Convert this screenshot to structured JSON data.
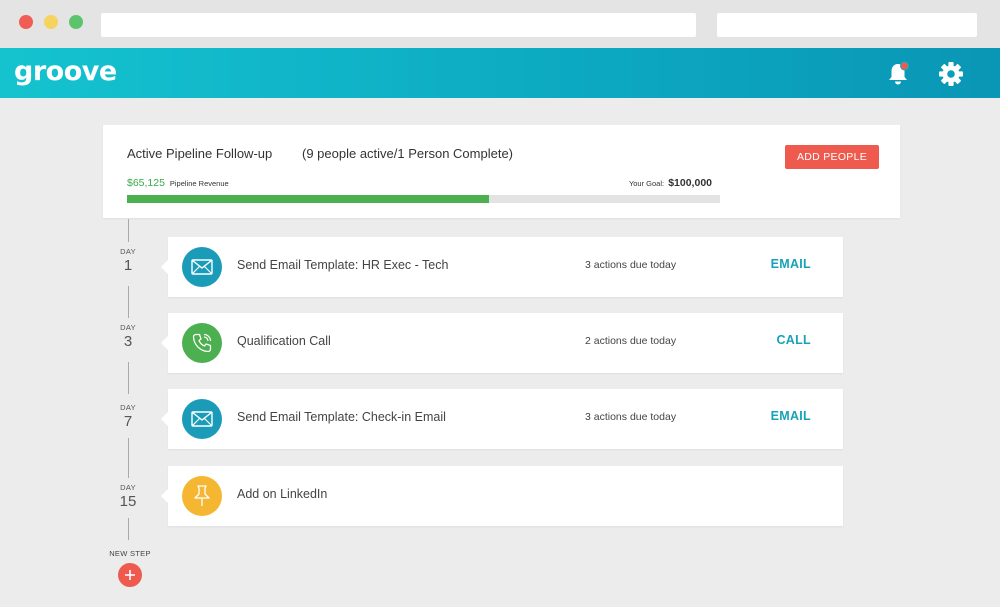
{
  "app": {
    "logo": "groove"
  },
  "header": {
    "icons": [
      "bell-icon",
      "gear-icon"
    ],
    "notification_dot_color": "#ef5a4e"
  },
  "pipeline": {
    "title": "Active Pipeline Follow-up",
    "status": "(9 people active/1 Person Complete)",
    "add_button": "ADD PEOPLE",
    "revenue_amount": "$65,125",
    "revenue_label": "Pipeline Revenue",
    "goal_label": "Your Goal:",
    "goal_value": "$100,000",
    "progress_fraction": 0.61
  },
  "steps": [
    {
      "day_label": "DAY",
      "day": "1",
      "icon": "email-icon",
      "color": "#1a9cb8",
      "title": "Send Email Template: HR Exec - Tech",
      "due": "3 actions due today",
      "action": "EMAIL"
    },
    {
      "day_label": "DAY",
      "day": "3",
      "icon": "phone-icon",
      "color": "#4caf50",
      "title": "Qualification Call",
      "due": "2 actions due today",
      "action": "CALL"
    },
    {
      "day_label": "DAY",
      "day": "7",
      "icon": "email-icon",
      "color": "#1a9cb8",
      "title": "Send Email Template: Check-in Email",
      "due": "3 actions due today",
      "action": "EMAIL"
    },
    {
      "day_label": "DAY",
      "day": "15",
      "icon": "pin-icon",
      "color": "#f5b731",
      "title": "Add on LinkedIn",
      "due": "",
      "action": ""
    }
  ],
  "new_step": {
    "label": "NEW STEP"
  },
  "colors": {
    "accent": "#17a2b8",
    "danger": "#ef5a4e",
    "success": "#4caf50"
  }
}
